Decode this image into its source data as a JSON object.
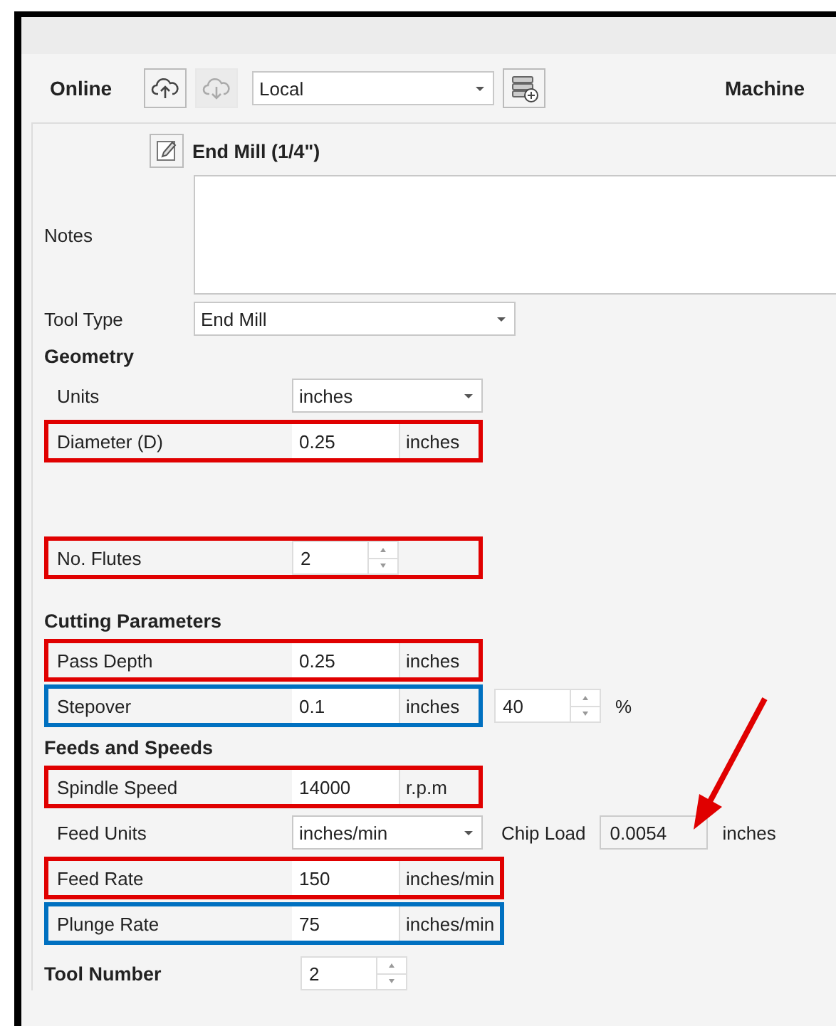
{
  "toolbar": {
    "label": "Online",
    "source": "Local",
    "machine": "Machine"
  },
  "tool": {
    "title": "End Mill (1/4\")",
    "notes_label": "Notes",
    "type_label": "Tool Type",
    "type_value": "End Mill"
  },
  "groups": [
    {
      "title": "Geometry",
      "rows": [
        {
          "kind": "select",
          "label": "Units",
          "value": "inches"
        },
        {
          "kind": "field",
          "label": "Diameter (D)",
          "value": "0.25",
          "unit": "inches",
          "color": "#e00000"
        }
      ]
    },
    {
      "rows": [
        {
          "kind": "spinner",
          "label": "No. Flutes",
          "value": "2",
          "color": "#e00000"
        }
      ]
    },
    {
      "title": "Cutting Parameters",
      "rows": [
        {
          "kind": "field",
          "label": "Pass Depth",
          "value": "0.25",
          "unit": "inches",
          "color": "#e00000"
        },
        {
          "kind": "field",
          "label": "Stepover",
          "value": "0.1",
          "unit": "inches",
          "color": "#0070c0",
          "extra": {
            "kind": "spinner",
            "value": "40",
            "unit": "%"
          }
        }
      ]
    },
    {
      "title": "Feeds and Speeds",
      "rows": [
        {
          "kind": "field",
          "label": "Spindle Speed",
          "value": "14000",
          "unit": "r.p.m",
          "color": "#e00000"
        },
        {
          "kind": "select",
          "label": "Feed Units",
          "value": "inches/min",
          "extra": {
            "kind": "readout",
            "label": "Chip Load",
            "value": "0.0054",
            "unit": "inches"
          }
        },
        {
          "kind": "field",
          "label": "Feed Rate",
          "value": "150",
          "unit": "inches/min",
          "color": "#e00000"
        },
        {
          "kind": "field",
          "label": "Plunge Rate",
          "value": "75",
          "unit": "inches/min",
          "color": "#0070c0"
        }
      ]
    }
  ],
  "tool_number": {
    "label": "Tool Number",
    "value": "2"
  }
}
